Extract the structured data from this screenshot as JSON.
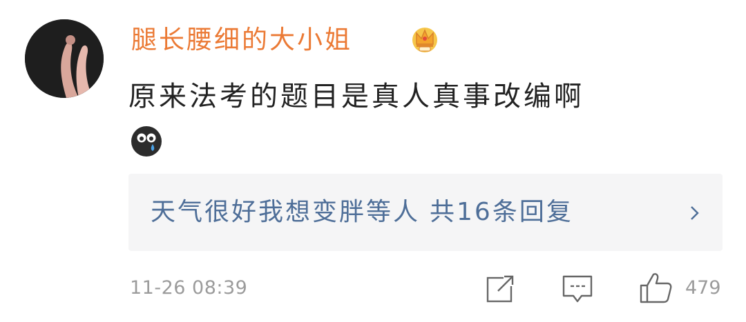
{
  "comment": {
    "username": "腿长腰细的大小姐",
    "badge_icon": "crown-badge-icon",
    "text": "原来法考的题目是真人真事改编啊",
    "emoji_icon": "crying-emoji-icon",
    "replies": {
      "preview": "天气很好我想变胖等人",
      "count_label": "共16条回复"
    },
    "timestamp": "11-26 08:39",
    "actions": {
      "like_count": "479"
    }
  },
  "colors": {
    "username": "#eb7a35",
    "reply_link": "#4e6e98",
    "meta_gray": "#9b9b9b",
    "reply_bg": "#f5f5f6"
  }
}
